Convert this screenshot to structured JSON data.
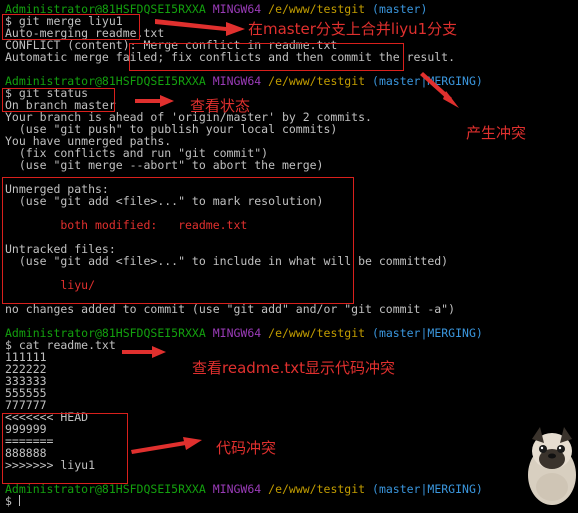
{
  "prompt": {
    "user": "Administrator@81HSFDQSEI5RXXA",
    "shell": "MINGW64",
    "path": "/e/www/testgit",
    "branch_master": "(master)",
    "branch_merging": "(master|MERGING)"
  },
  "cmd1": {
    "command": "$ git merge liyu1",
    "lines": [
      "Auto-merging readme.txt",
      "CONFLICT (content): Merge conflict in readme.txt",
      "Automatic merge failed; fix conflicts and then commit the result."
    ]
  },
  "cmd2": {
    "command": "$ git status",
    "lines": [
      "On branch master",
      "Your branch is ahead of 'origin/master' by 2 commits.",
      "  (use \"git push\" to publish your local commits)",
      "You have unmerged paths.",
      "  (fix conflicts and run \"git commit\")",
      "  (use \"git merge --abort\" to abort the merge)"
    ],
    "unmerged": [
      "Unmerged paths:",
      "  (use \"git add <file>...\" to mark resolution)"
    ],
    "modified": "        both modified:   readme.txt",
    "untracked": [
      "Untracked files:",
      "  (use \"git add <file>...\" to include in what will be committed)"
    ],
    "untracked_file": "        liyu/",
    "footer": "no changes added to commit (use \"git add\" and/or \"git commit -a\")"
  },
  "cmd3": {
    "command": "$ cat readme.txt",
    "lines": [
      "111111",
      "222222",
      "333333",
      "555555",
      "777777"
    ],
    "conflict": [
      "<<<<<<< HEAD",
      "999999",
      "=======",
      "888888",
      ">>>>>>> liyu1"
    ]
  },
  "prompt4": {
    "cursor": "$ "
  },
  "annotations": {
    "merge": "在master分支上合并liyu1分支",
    "conflict": "产生冲突",
    "status": "查看状态",
    "cat": "查看readme.txt显示代码冲突",
    "code_conflict": "代码冲突"
  },
  "colors": {
    "user": "#13a10e",
    "host": "#9a3bb8",
    "path": "#c19c00",
    "branch": "#3a96dd",
    "annotation": "#e0302e"
  }
}
